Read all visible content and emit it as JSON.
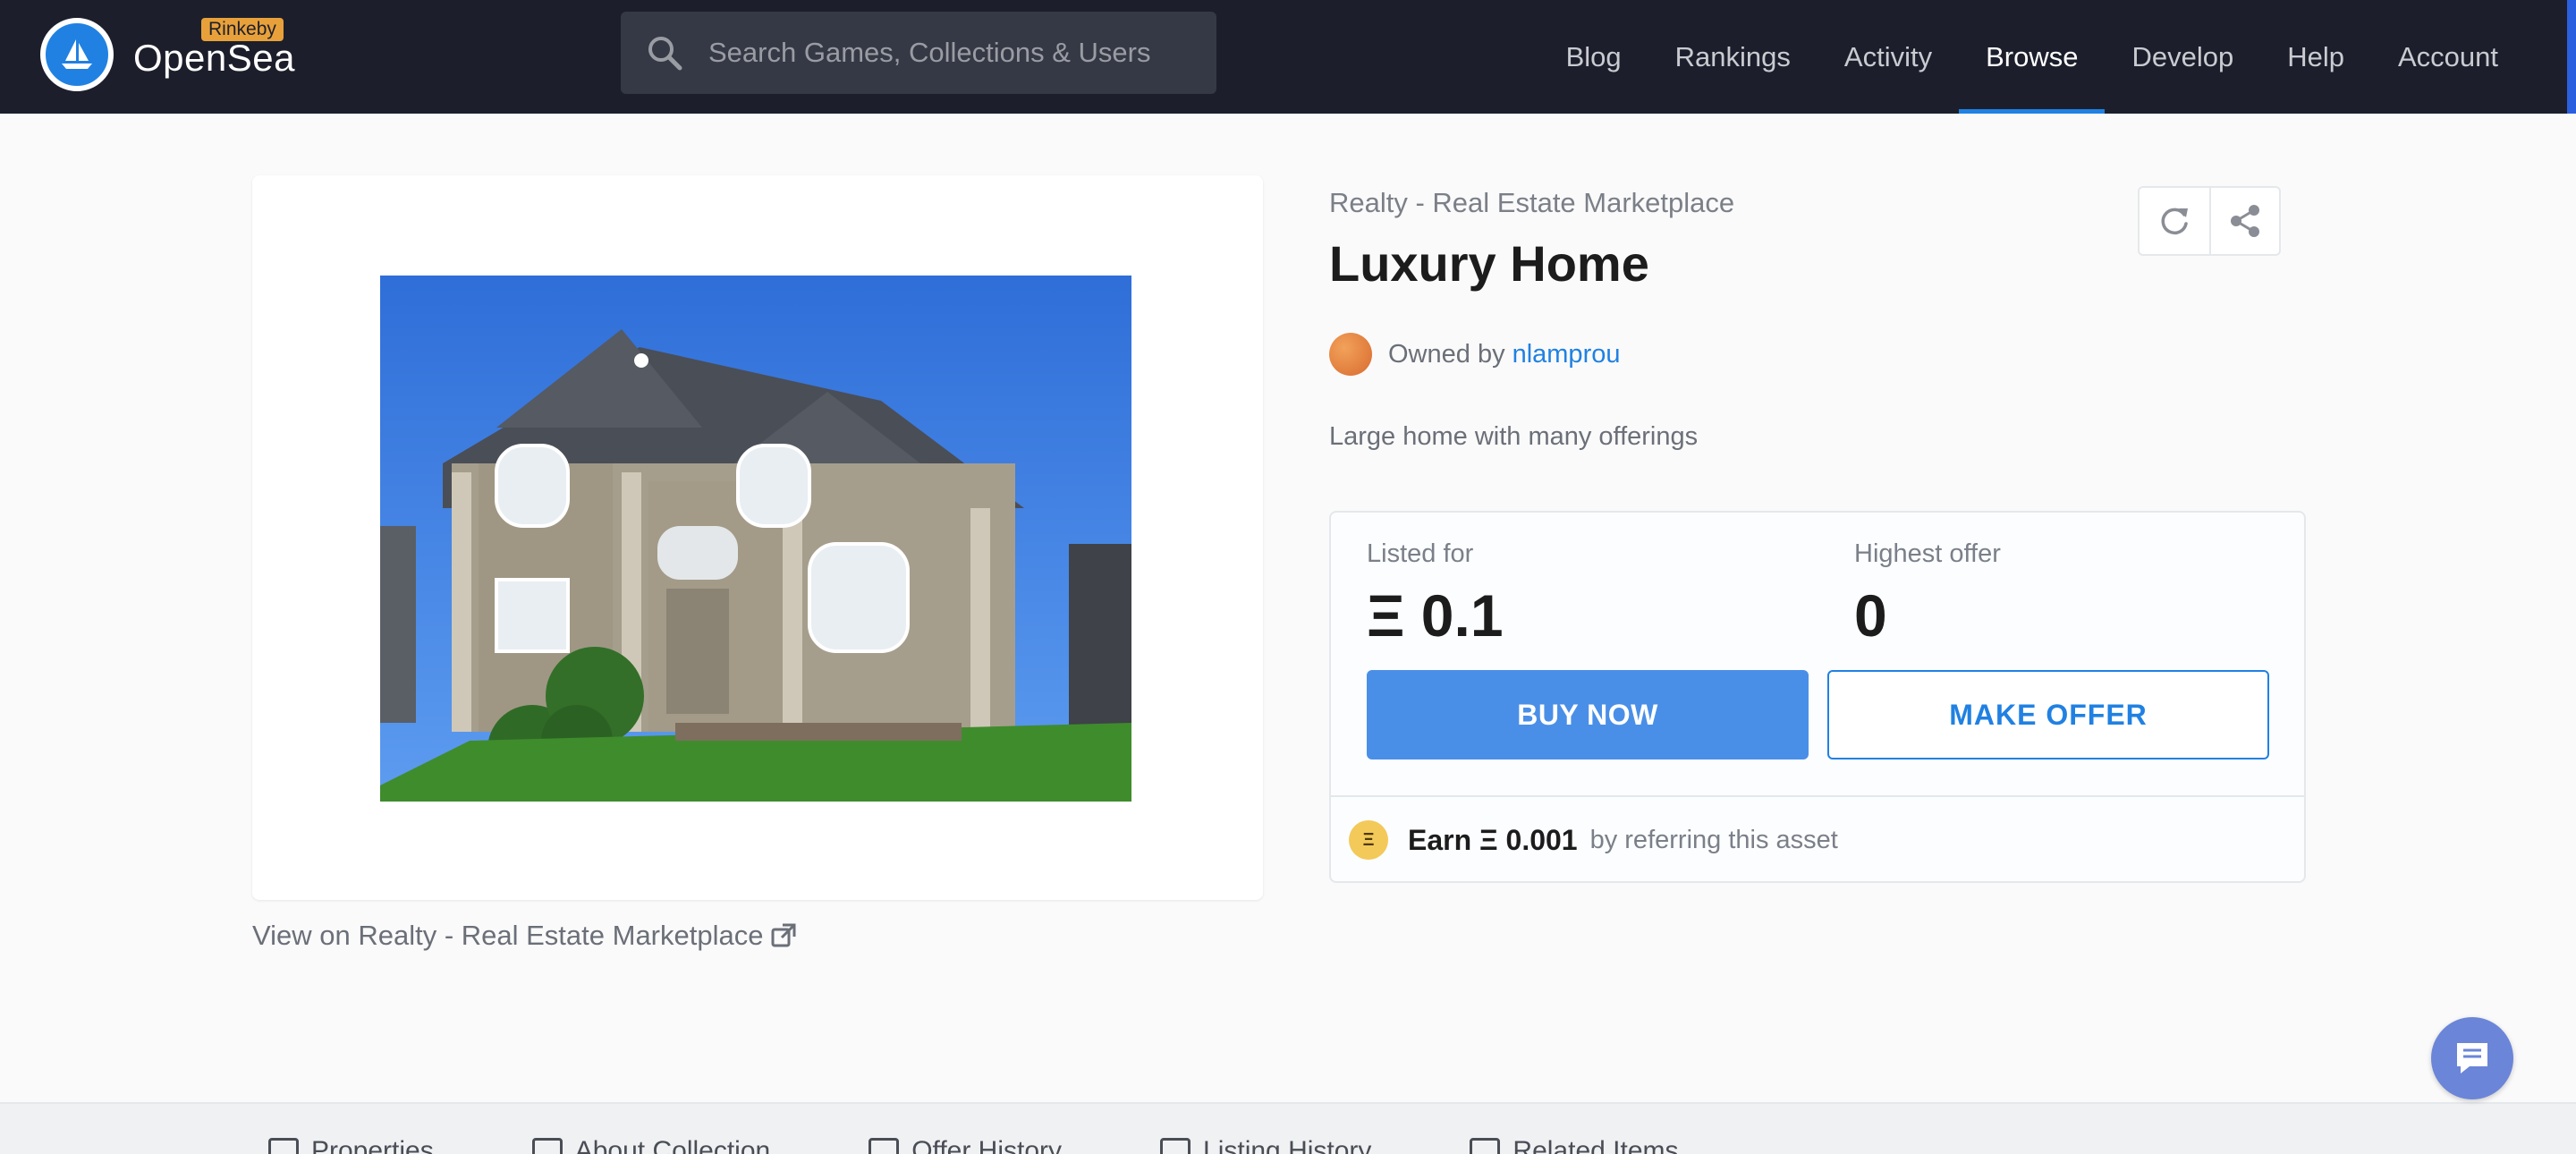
{
  "header": {
    "brand": "OpenSea",
    "network_badge": "Rinkeby",
    "search_placeholder": "Search Games, Collections & Users",
    "nav": [
      {
        "label": "Blog",
        "active": false
      },
      {
        "label": "Rankings",
        "active": false
      },
      {
        "label": "Activity",
        "active": false
      },
      {
        "label": "Browse",
        "active": true
      },
      {
        "label": "Develop",
        "active": false
      },
      {
        "label": "Help",
        "active": false
      },
      {
        "label": "Account",
        "active": false
      }
    ]
  },
  "asset": {
    "collection": "Realty - Real Estate Marketplace",
    "title": "Luxury Home",
    "owned_by_prefix": "Owned by",
    "owner": "nlamprou",
    "description": "Large home with many offerings",
    "view_link": "View on Realty - Real Estate Marketplace"
  },
  "pricing": {
    "listed_label": "Listed for",
    "listed_value": "Ξ 0.1",
    "offer_label": "Highest offer",
    "offer_value": "0",
    "buy_label": "BUY NOW",
    "offer_button_label": "MAKE OFFER",
    "earn_coin": "Ξ",
    "earn_strong": "Earn Ξ 0.001",
    "earn_rest": "by referring this asset"
  },
  "tabs": [
    {
      "label": "Properties"
    },
    {
      "label": "About Collection"
    },
    {
      "label": "Offer History"
    },
    {
      "label": "Listing History"
    },
    {
      "label": "Related Items"
    }
  ],
  "colors": {
    "header_bg": "#1c1f2b",
    "accent": "#2081e2",
    "buy_button": "#4a8fe7"
  }
}
